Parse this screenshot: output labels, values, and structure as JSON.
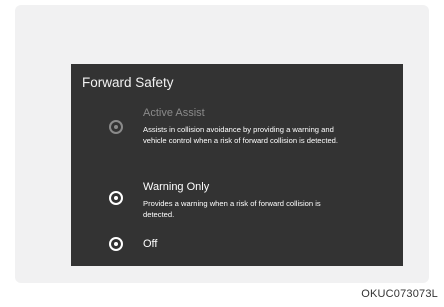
{
  "screen": {
    "title": "Forward Safety",
    "options": [
      {
        "label": "Active Assist",
        "description": "Assists in collision avoidance by providing a warning and vehicle control when a risk of forward collision is detected.",
        "disabled": true
      },
      {
        "label": "Warning Only",
        "description": "Provides a warning when a risk of forward collision is detected.",
        "disabled": false
      },
      {
        "label": "Off",
        "description": "",
        "disabled": false
      }
    ]
  },
  "figure_code": "OKUC073073L",
  "colors": {
    "screen_background": "#333333",
    "frame_background": "#f1f1f2",
    "disabled_text": "#8a8a8a",
    "text": "#ffffff"
  }
}
